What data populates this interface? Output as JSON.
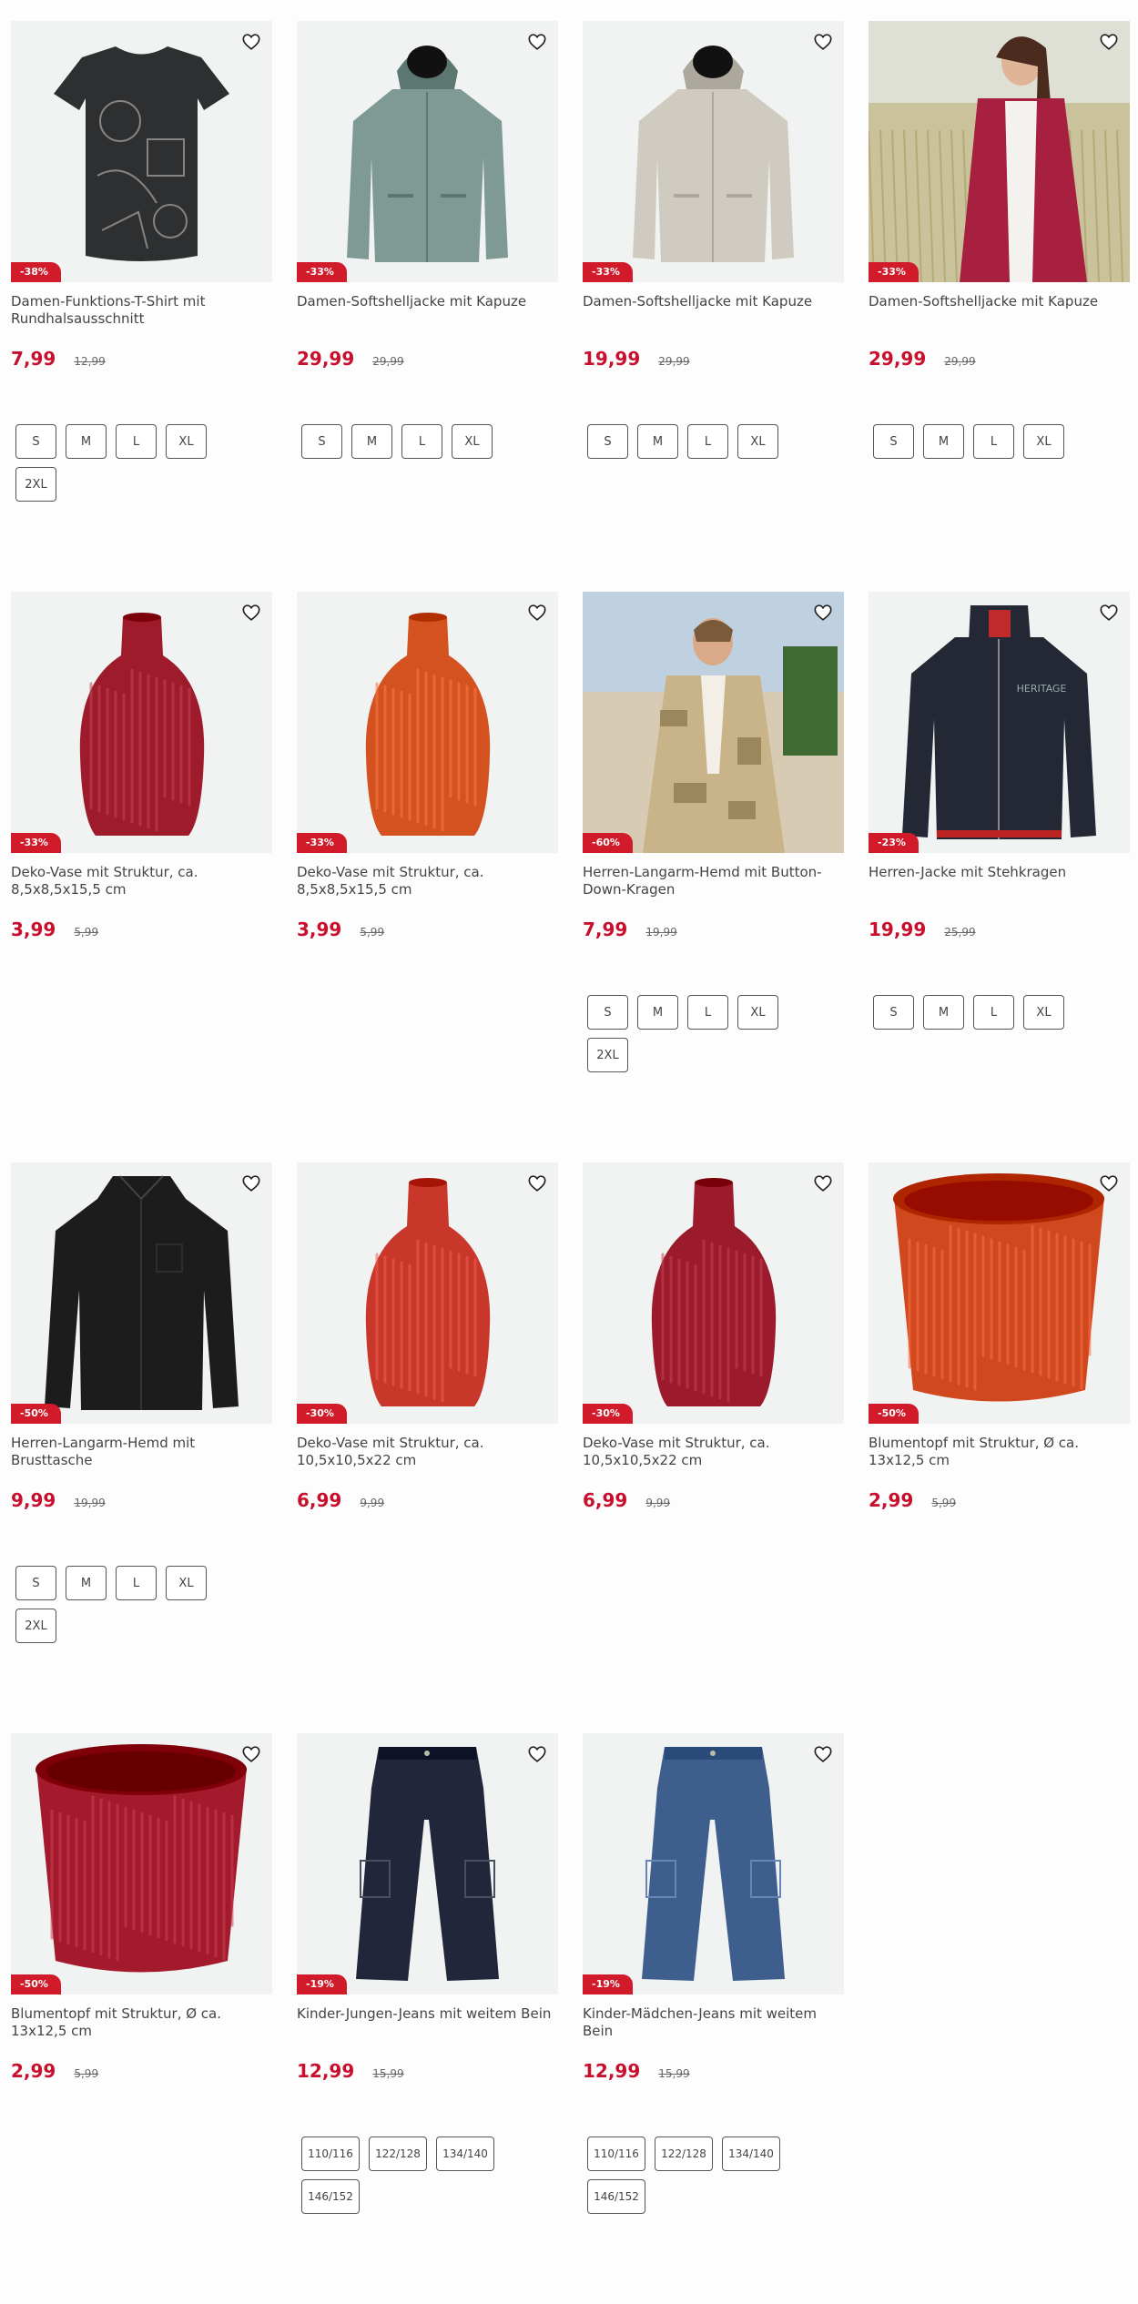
{
  "products": [
    {
      "title": "Damen-Funktions-T-Shirt mit Rundhalsausschnitt",
      "price": "7,99",
      "old_price": "12,99",
      "discount": "-38%",
      "image": "tshirt-print",
      "color": "#2e2f30",
      "sizes": [
        "S",
        "M",
        "L",
        "XL",
        "2XL"
      ]
    },
    {
      "title": "Damen-Softshelljacke mit Kapuze",
      "price": "29,99",
      "old_price": "29,99",
      "discount": "-33%",
      "image": "hooded-jacket",
      "color": "#7f9a94",
      "sizes": [
        "S",
        "M",
        "L",
        "XL"
      ]
    },
    {
      "title": "Damen-Softshelljacke mit Kapuze",
      "price": "19,99",
      "old_price": "29,99",
      "discount": "-33%",
      "image": "hooded-jacket",
      "color": "#cfcbc0",
      "sizes": [
        "S",
        "M",
        "L",
        "XL"
      ]
    },
    {
      "title": "Damen-Softshelljacke mit Kapuze",
      "price": "29,99",
      "old_price": "29,99",
      "discount": "-33%",
      "image": "model-woman-jacket",
      "color": "#a8203f",
      "sizes": [
        "S",
        "M",
        "L",
        "XL"
      ]
    },
    {
      "title": "Deko-Vase mit Struktur, ca. 8,5x8,5x15,5 cm",
      "price": "3,99",
      "old_price": "5,99",
      "discount": "-33%",
      "image": "vase",
      "color": "#9e1b2c",
      "sizes": []
    },
    {
      "title": "Deko-Vase mit Struktur, ca. 8,5x8,5x15,5 cm",
      "price": "3,99",
      "old_price": "5,99",
      "discount": "-33%",
      "image": "vase",
      "color": "#d4521f",
      "sizes": []
    },
    {
      "title": "Herren-Langarm-Hemd mit Button-Down-Kragen",
      "price": "7,99",
      "old_price": "19,99",
      "discount": "-60%",
      "image": "model-man-shirt",
      "color": "#c9b48a",
      "sizes": [
        "S",
        "M",
        "L",
        "XL",
        "2XL"
      ]
    },
    {
      "title": "Herren-Jacke mit Stehkragen",
      "price": "19,99",
      "old_price": "25,99",
      "discount": "-23%",
      "image": "zip-jacket",
      "color": "#232834",
      "sizes": [
        "S",
        "M",
        "L",
        "XL"
      ]
    },
    {
      "title": "Herren-Langarm-Hemd mit Brusttasche",
      "price": "9,99",
      "old_price": "19,99",
      "discount": "-50%",
      "image": "shirt",
      "color": "#1c1c1c",
      "sizes": [
        "S",
        "M",
        "L",
        "XL",
        "2XL"
      ]
    },
    {
      "title": "Deko-Vase mit Struktur, ca. 10,5x10,5x22 cm",
      "price": "6,99",
      "old_price": "9,99",
      "discount": "-30%",
      "image": "vase-tall",
      "color": "#c8372a",
      "sizes": []
    },
    {
      "title": "Deko-Vase mit Struktur, ca. 10,5x10,5x22 cm",
      "price": "6,99",
      "old_price": "9,99",
      "discount": "-30%",
      "image": "vase-tall",
      "color": "#9b1a2b",
      "sizes": []
    },
    {
      "title": "Blumentopf mit Struktur, Ø ca. 13x12,5 cm",
      "price": "2,99",
      "old_price": "5,99",
      "discount": "-50%",
      "image": "flowerpot",
      "color": "#d2481e",
      "sizes": []
    },
    {
      "title": "Blumentopf mit Struktur, Ø ca. 13x12,5 cm",
      "price": "2,99",
      "old_price": "5,99",
      "discount": "-50%",
      "image": "flowerpot",
      "color": "#a21a2c",
      "sizes": []
    },
    {
      "title": "Kinder-Jungen-Jeans mit weitem Bein",
      "price": "12,99",
      "old_price": "15,99",
      "discount": "-19%",
      "image": "jeans",
      "color": "#22263a",
      "sizes": [
        "110/116",
        "122/128",
        "134/140",
        "146/152"
      ]
    },
    {
      "title": "Kinder-Mädchen-Jeans mit weitem Bein",
      "price": "12,99",
      "old_price": "15,99",
      "discount": "-19%",
      "image": "jeans",
      "color": "#3e5f8e",
      "sizes": [
        "110/116",
        "122/128",
        "134/140",
        "146/152"
      ]
    }
  ],
  "icons": {
    "wishlist": "heart-outline-icon"
  },
  "colors": {
    "price": "#c8102e",
    "badge": "#d11a2a"
  }
}
